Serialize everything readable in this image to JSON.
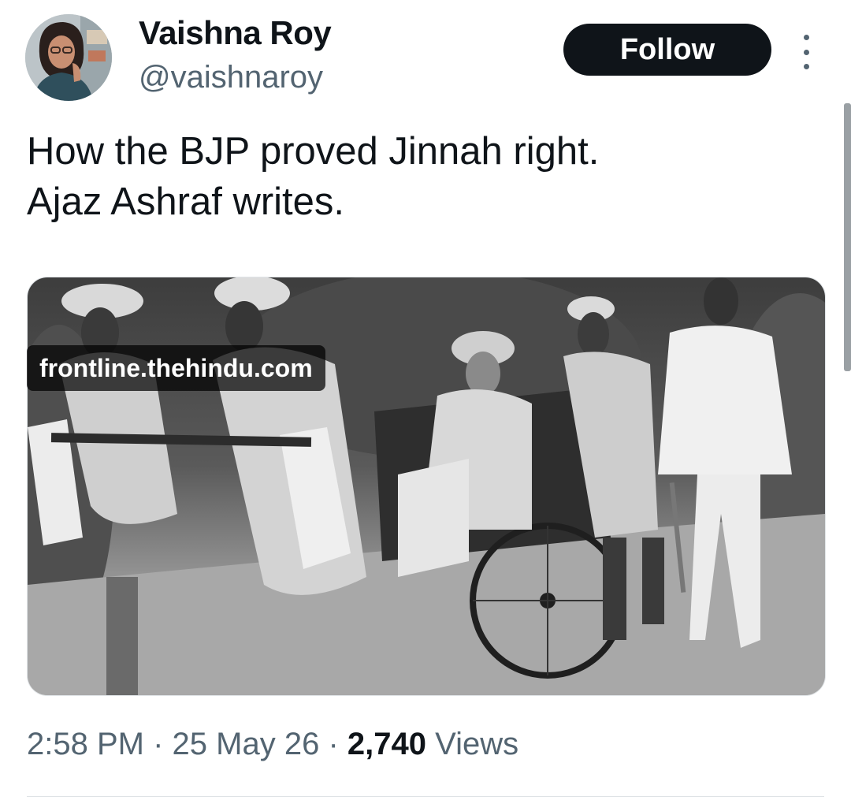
{
  "author": {
    "display_name": "Vaishna Roy",
    "handle": "@vaishnaroy"
  },
  "actions": {
    "follow_label": "Follow",
    "more_icon": "more-options-icon"
  },
  "tweet": {
    "text_lines": [
      "How the BJP proved Jinnah right.",
      "Ajaz Ashraf writes."
    ]
  },
  "media": {
    "link_domain": "frontline.thehindu.com"
  },
  "meta": {
    "time": "2:58 PM",
    "separator": "·",
    "date": "25 May 26",
    "views_count": "2,740",
    "views_label": "Views"
  },
  "colors": {
    "text_primary": "#0f1419",
    "text_secondary": "#536471",
    "button_bg": "#0f1419",
    "button_text": "#ffffff"
  }
}
